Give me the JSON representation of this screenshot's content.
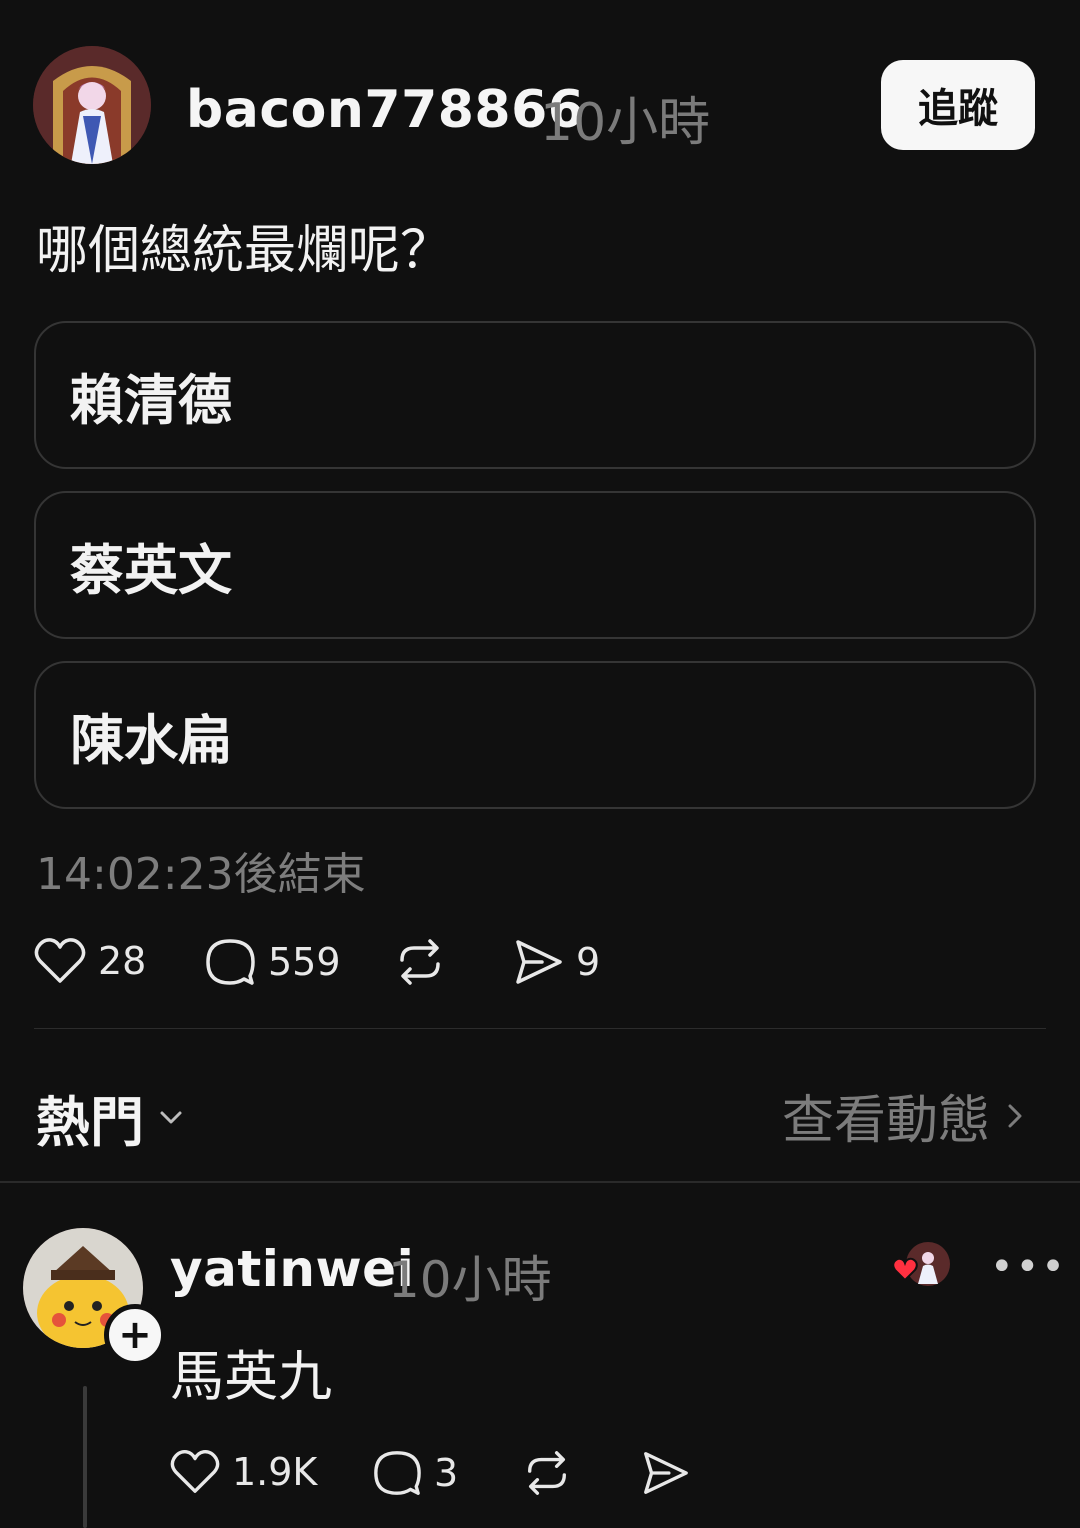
{
  "post": {
    "username": "bacon778866",
    "time": "10小時",
    "follow_label": "追蹤",
    "text": "哪個總統最爛呢？",
    "poll_options": [
      "賴清德",
      "蔡英文",
      "陳水扁"
    ],
    "poll_countdown": "14:02:23後結束",
    "actions": {
      "likes": "28",
      "comments": "559",
      "shares": "9"
    }
  },
  "replies_header": {
    "sort_label": "熱門",
    "activity_link": "查看動態"
  },
  "reply": {
    "username": "yatinwei",
    "time": "10小時",
    "text": "馬英九",
    "actions": {
      "likes": "1.9K",
      "comments": "3"
    }
  },
  "icons": {
    "like": "heart-icon",
    "comment": "comment-bubble-icon",
    "repost": "repost-icon",
    "share": "send-icon",
    "more": "more-icon",
    "chevron_down": "chevron-down-icon",
    "chevron_right": "chevron-right-icon",
    "plus": "plus-icon"
  },
  "colors": {
    "background": "#101010",
    "text": "#f3f3f3",
    "muted": "#7b7b7b",
    "border": "#353535",
    "like_heart": "#ff3040"
  }
}
